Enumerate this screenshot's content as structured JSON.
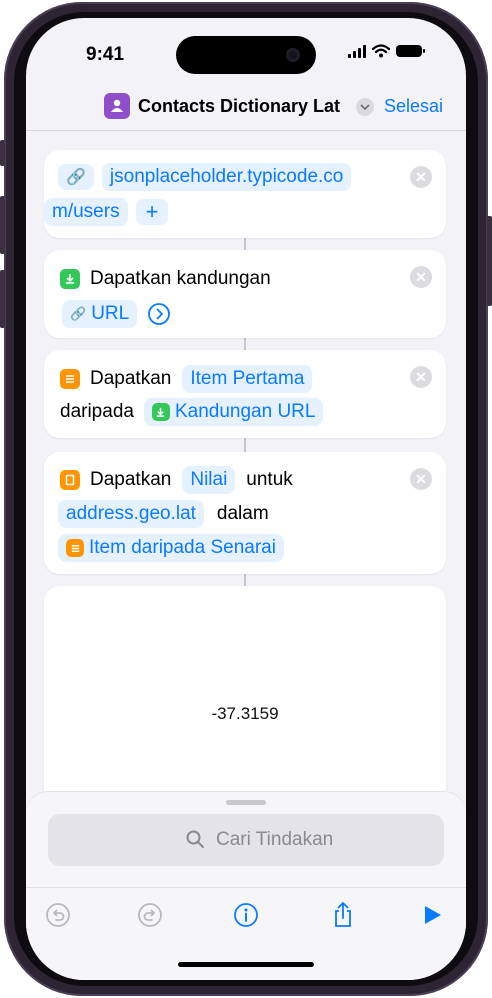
{
  "status": {
    "time": "9:41"
  },
  "nav": {
    "title": "Contacts Dictionary Lat",
    "done_label": "Selesai"
  },
  "actions": {
    "url": {
      "line1": "jsonplaceholder.typicode.co",
      "line2": "m/users",
      "add_label": "+"
    },
    "get_contents": {
      "label": "Dapatkan kandungan",
      "param": "URL"
    },
    "get_item": {
      "verb": "Dapatkan",
      "item": "Item Pertama",
      "from": "daripada",
      "source": "Kandungan URL"
    },
    "get_value": {
      "verb": "Dapatkan",
      "value": "Nilai",
      "for": "untuk",
      "key": "address.geo.lat",
      "in": "dalam",
      "source": "Item daripada Senarai"
    }
  },
  "result": {
    "value": "-37.3159"
  },
  "search": {
    "placeholder": "Cari Tindakan"
  },
  "colors": {
    "accent": "#0a7aff",
    "green": "#34c759",
    "orange": "#ff9500",
    "purple": "#8e4fc9"
  }
}
